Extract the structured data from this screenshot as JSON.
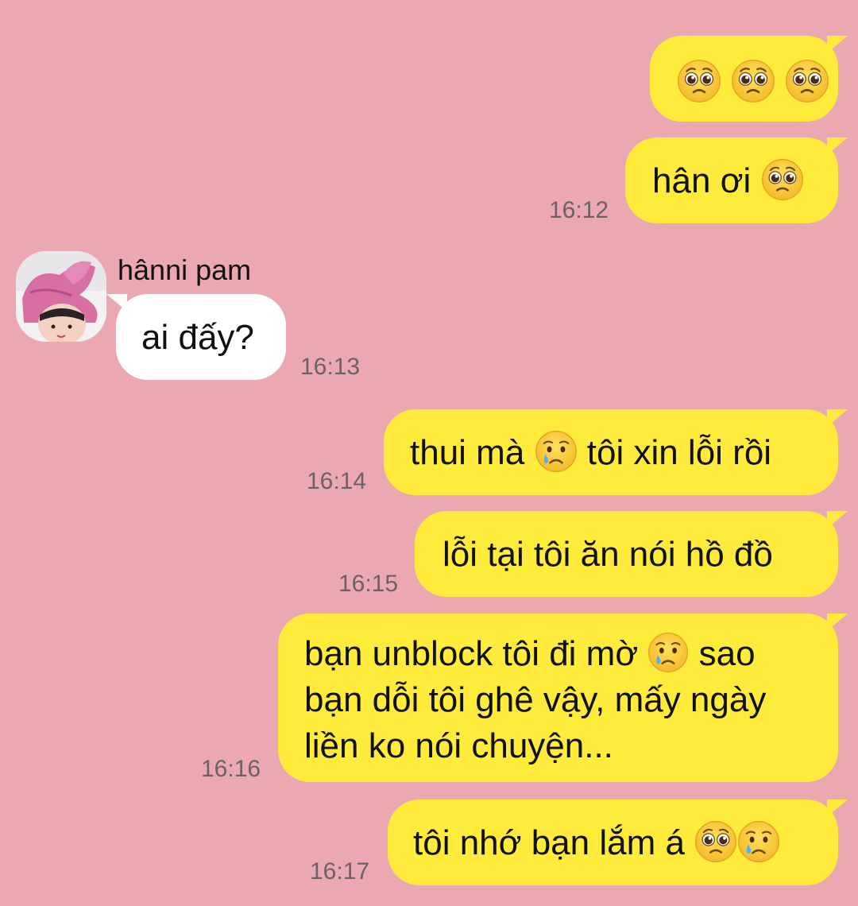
{
  "conversation": {
    "contact_name": "hânni pam",
    "messages": [
      {
        "id": "m1",
        "direction": "outgoing",
        "text": "",
        "emojis": [
          "pleading-face",
          "pleading-face",
          "pleading-face"
        ],
        "time": ""
      },
      {
        "id": "m2",
        "direction": "outgoing",
        "text": "hân ơi",
        "emojis": [
          "pleading-face"
        ],
        "time": "16:12"
      },
      {
        "id": "m3",
        "direction": "incoming",
        "text": "ai đấy?",
        "time": "16:13"
      },
      {
        "id": "m4",
        "direction": "outgoing",
        "text_before": "thui mà",
        "emoji": "crying-face",
        "text_after": "tôi xin lỗi rồi",
        "time": "16:14"
      },
      {
        "id": "m5",
        "direction": "outgoing",
        "text": "lỗi tại tôi ăn nói hồ đồ",
        "time": "16:15"
      },
      {
        "id": "m6",
        "direction": "outgoing",
        "line1_before": "bạn unblock tôi đi mờ",
        "emoji": "crying-face",
        "line1_after": "sao",
        "line2": "bạn dỗi tôi ghê vậy, mấy ngày",
        "line3": "liền ko nói chuyện...",
        "time": "16:16"
      },
      {
        "id": "m7",
        "direction": "outgoing",
        "text": "tôi nhớ bạn lắm á",
        "emojis": [
          "pleading-face",
          "crying-face"
        ],
        "time": "16:17"
      }
    ]
  },
  "colors": {
    "background": "#eba8b1",
    "outgoing_bubble": "#ffeb3b",
    "incoming_bubble": "#ffffff",
    "timestamp": "#6b6266"
  }
}
